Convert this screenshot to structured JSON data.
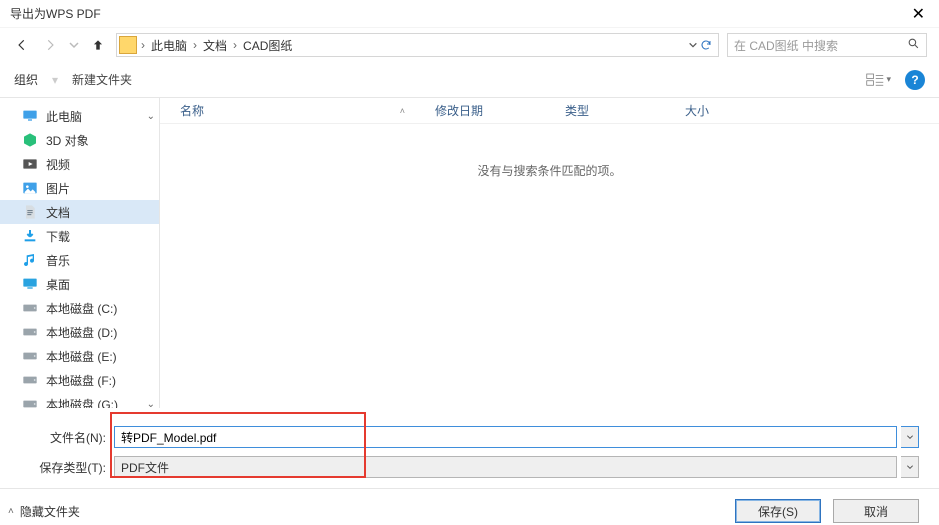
{
  "window": {
    "title": "导出为WPS PDF"
  },
  "nav": {
    "back_enabled": true,
    "fwd_enabled": false
  },
  "breadcrumb": {
    "items": [
      "此电脑",
      "文档",
      "CAD图纸"
    ]
  },
  "search": {
    "placeholder": "在 CAD图纸 中搜索"
  },
  "toolbar": {
    "organize": "组织",
    "newfolder": "新建文件夹"
  },
  "sidebar": {
    "items": [
      {
        "label": "此电脑",
        "icon": "monitor",
        "caret": true
      },
      {
        "label": "3D 对象",
        "icon": "cube"
      },
      {
        "label": "视频",
        "icon": "video"
      },
      {
        "label": "图片",
        "icon": "picture"
      },
      {
        "label": "文档",
        "icon": "doc",
        "selected": true
      },
      {
        "label": "下载",
        "icon": "download"
      },
      {
        "label": "音乐",
        "icon": "music"
      },
      {
        "label": "桌面",
        "icon": "desktop"
      },
      {
        "label": "本地磁盘 (C:)",
        "icon": "disk"
      },
      {
        "label": "本地磁盘 (D:)",
        "icon": "disk"
      },
      {
        "label": "本地磁盘 (E:)",
        "icon": "disk"
      },
      {
        "label": "本地磁盘 (F:)",
        "icon": "disk"
      },
      {
        "label": "本地磁盘 (G:)",
        "icon": "disk",
        "caret": true
      }
    ]
  },
  "columns": {
    "name": "名称",
    "date": "修改日期",
    "type": "类型",
    "size": "大小"
  },
  "listing": {
    "empty_msg": "没有与搜索条件匹配的项。"
  },
  "form": {
    "filename_label": "文件名(N):",
    "filename_value": "转PDF_Model.pdf",
    "filetype_label": "保存类型(T):",
    "filetype_value": "PDF文件"
  },
  "footer": {
    "hide_folders": "隐藏文件夹",
    "save": "保存(S)",
    "cancel": "取消"
  }
}
